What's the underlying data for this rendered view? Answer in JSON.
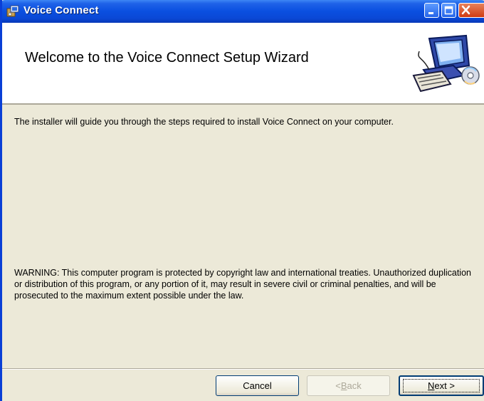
{
  "window": {
    "title": "Voice Connect",
    "minimize_label": "",
    "maximize_label": "",
    "close_label": ""
  },
  "header": {
    "title": "Welcome to the Voice Connect Setup Wizard"
  },
  "body": {
    "intro": "The installer will guide you through the steps required to install Voice Connect on your computer.",
    "warning": "WARNING: This computer program is protected by copyright law and international treaties. Unauthorized duplication or distribution of this program, or any portion of it, may result in severe civil or criminal penalties, and will be prosecuted to the maximum extent possible under the law."
  },
  "buttons": {
    "cancel": "Cancel",
    "back_prefix": "< ",
    "back_accel": "B",
    "back_rest": "ack",
    "next_accel": "N",
    "next_rest": "ext >"
  },
  "colors": {
    "titlebar": "#0a4fe0",
    "dialog_bg": "#ece9d8",
    "close_button": "#cf3b12"
  }
}
